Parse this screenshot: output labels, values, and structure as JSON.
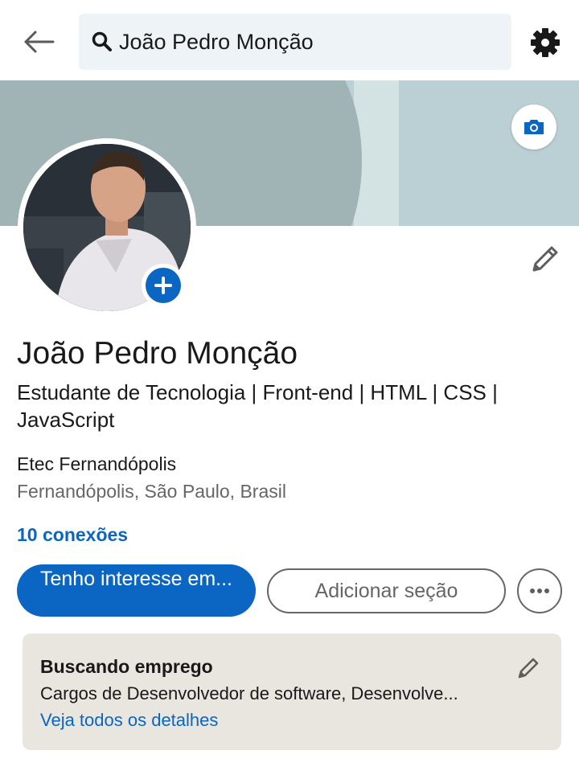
{
  "topbar": {
    "back_icon": "arrow-left-icon",
    "search_value": "João Pedro Monção",
    "search_icon": "search-icon",
    "settings_icon": "gear-icon"
  },
  "banner": {
    "camera_icon": "camera-icon"
  },
  "profile": {
    "name": "João Pedro Monção",
    "headline": "Estudante de Tecnologia | Front-end | HTML | CSS | JavaScript",
    "school": "Etec Fernandópolis",
    "location": "Fernandópolis, São Paulo, Brasil",
    "connections": "10 conexões",
    "add_photo_icon": "plus-icon",
    "edit_icon": "pencil-icon"
  },
  "actions": {
    "primary_label": "Tenho interesse em...",
    "secondary_label": "Adicionar seção",
    "more_icon": "more-horizontal-icon"
  },
  "open_to_work": {
    "title": "Buscando emprego",
    "description": "Cargos de Desenvolvedor de software, Desenvolve...",
    "link": "Veja todos os detalhes",
    "edit_icon": "pencil-icon"
  },
  "colors": {
    "brand_blue": "#0a66c2",
    "card_bg": "#e9e5df",
    "banner_teal": "#a0b4b6"
  }
}
